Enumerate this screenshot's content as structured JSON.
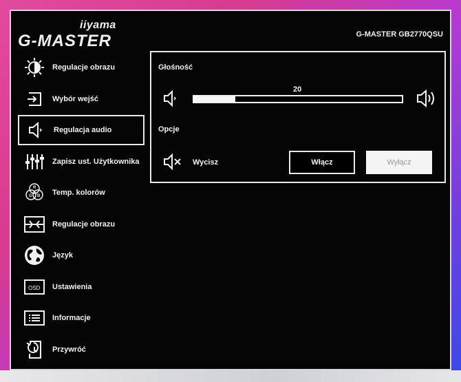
{
  "brand": {
    "maker": "iiyama",
    "series": "G-MASTER"
  },
  "model": "G-MASTER GB2770QSU",
  "menu": [
    {
      "label": "Regulacje obrazu",
      "icon": "brightness-icon"
    },
    {
      "label": "Wybór wejść",
      "icon": "input-icon"
    },
    {
      "label": "Regulacja audio",
      "icon": "speaker-icon",
      "selected": true
    },
    {
      "label": "Zapisz ust. Użytkownika",
      "icon": "sliders-icon"
    },
    {
      "label": "Temp. kolorów",
      "icon": "rgb-icon"
    },
    {
      "label": "Regulacje obrazu",
      "icon": "image-adjust-icon"
    },
    {
      "label": "Język",
      "icon": "globe-icon"
    },
    {
      "label": "Ustawienia",
      "icon": "osd-icon"
    },
    {
      "label": "Informacje",
      "icon": "info-icon"
    },
    {
      "label": "Przywróć",
      "icon": "reset-icon"
    }
  ],
  "audio": {
    "volume_label": "Głośność",
    "volume_value": "20",
    "volume_fraction": 0.2,
    "options_label": "Opcje",
    "mute_label": "Wycisz",
    "on_label": "Włącz",
    "off_label": "Wyłącz"
  }
}
